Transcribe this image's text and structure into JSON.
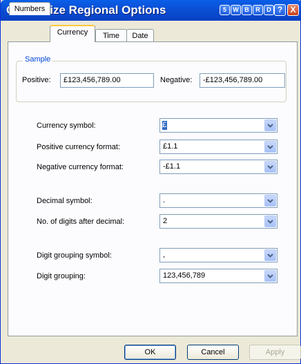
{
  "window": {
    "title": "Customize Regional Options",
    "titlebar_buttons": [
      "5",
      "W",
      "B",
      "R",
      "D"
    ],
    "help_label": "?",
    "close_label": "X"
  },
  "tabs": [
    {
      "label": "Numbers"
    },
    {
      "label": "Currency"
    },
    {
      "label": "Time"
    },
    {
      "label": "Date"
    }
  ],
  "sample": {
    "group_label": "Sample",
    "positive_label": "Positive:",
    "positive_value": "£123,456,789.00",
    "negative_label": "Negative:",
    "negative_value": "-£123,456,789.00"
  },
  "settings": [
    {
      "label": "Currency symbol:",
      "value": "£"
    },
    {
      "label": "Positive currency format:",
      "value": "£1.1"
    },
    {
      "label": "Negative currency format:",
      "value": "-£1.1"
    },
    {
      "label": "Decimal symbol:",
      "value": "."
    },
    {
      "label": "No. of digits after decimal:",
      "value": "2"
    },
    {
      "label": "Digit grouping symbol:",
      "value": ","
    },
    {
      "label": "Digit grouping:",
      "value": "123,456,789"
    }
  ],
  "buttons": {
    "ok": "OK",
    "cancel": "Cancel",
    "apply": "Apply"
  },
  "icons": {
    "dropdown": "chevron-down-icon",
    "help": "help-icon",
    "close": "close-icon"
  },
  "colors": {
    "titlebar": "#0a4fd4",
    "active_tab_accent": "#ffc83c",
    "group_label": "#0046d5"
  }
}
